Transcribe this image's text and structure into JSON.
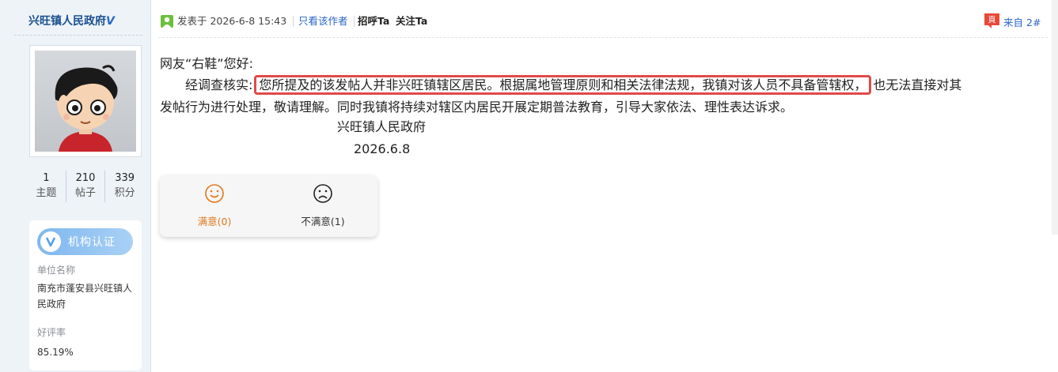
{
  "sidebar": {
    "user_name": "兴旺镇人民政府",
    "vip_mark": "V",
    "stats": [
      {
        "num": "1",
        "label": "主题"
      },
      {
        "num": "210",
        "label": "帖子"
      },
      {
        "num": "339",
        "label": "积分"
      }
    ],
    "org": {
      "cert_label": "机构认证",
      "unit_key": "单位名称",
      "unit_value": "南充市蓬安县兴旺镇人民政府",
      "rating_key": "好评率",
      "rating_value": "85.19%"
    }
  },
  "post": {
    "posted_prefix": "发表于 2026-6-8 15:43",
    "only_author": "只看该作者",
    "greet_ta": "招呼Ta",
    "follow_ta": "关注Ta",
    "from_label": "来自",
    "floor": "2#",
    "greeting": "网友“右鞋”您好:",
    "lead": "经调查核实:",
    "highlight": "您所提及的该发帖人并非兴旺镇辖区居民。根据属地管理原则和相关法律法规，我镇对该人员不具备管辖权，",
    "tail": "也无法直接对其",
    "line2": "发帖行为进行处理，敬请理解。同时我镇将持续对辖区内居民开展定期普法教育，引导大家依法、理性表达诉求。",
    "signature": "兴旺镇人民政府",
    "date": "2026.6.8"
  },
  "rating": {
    "satisfied": "满意(0)",
    "unsatisfied": "不满意(1)"
  },
  "colors": {
    "sidebar_bg": "#eef3f8",
    "link": "#2a66c8",
    "highlight_border": "#e04a4a",
    "satisfied": "#e0771a"
  },
  "icons": [
    "avatar-cartoon",
    "poster-icon",
    "from-icon",
    "cert-v-icon",
    "smile-icon",
    "frown-icon"
  ]
}
